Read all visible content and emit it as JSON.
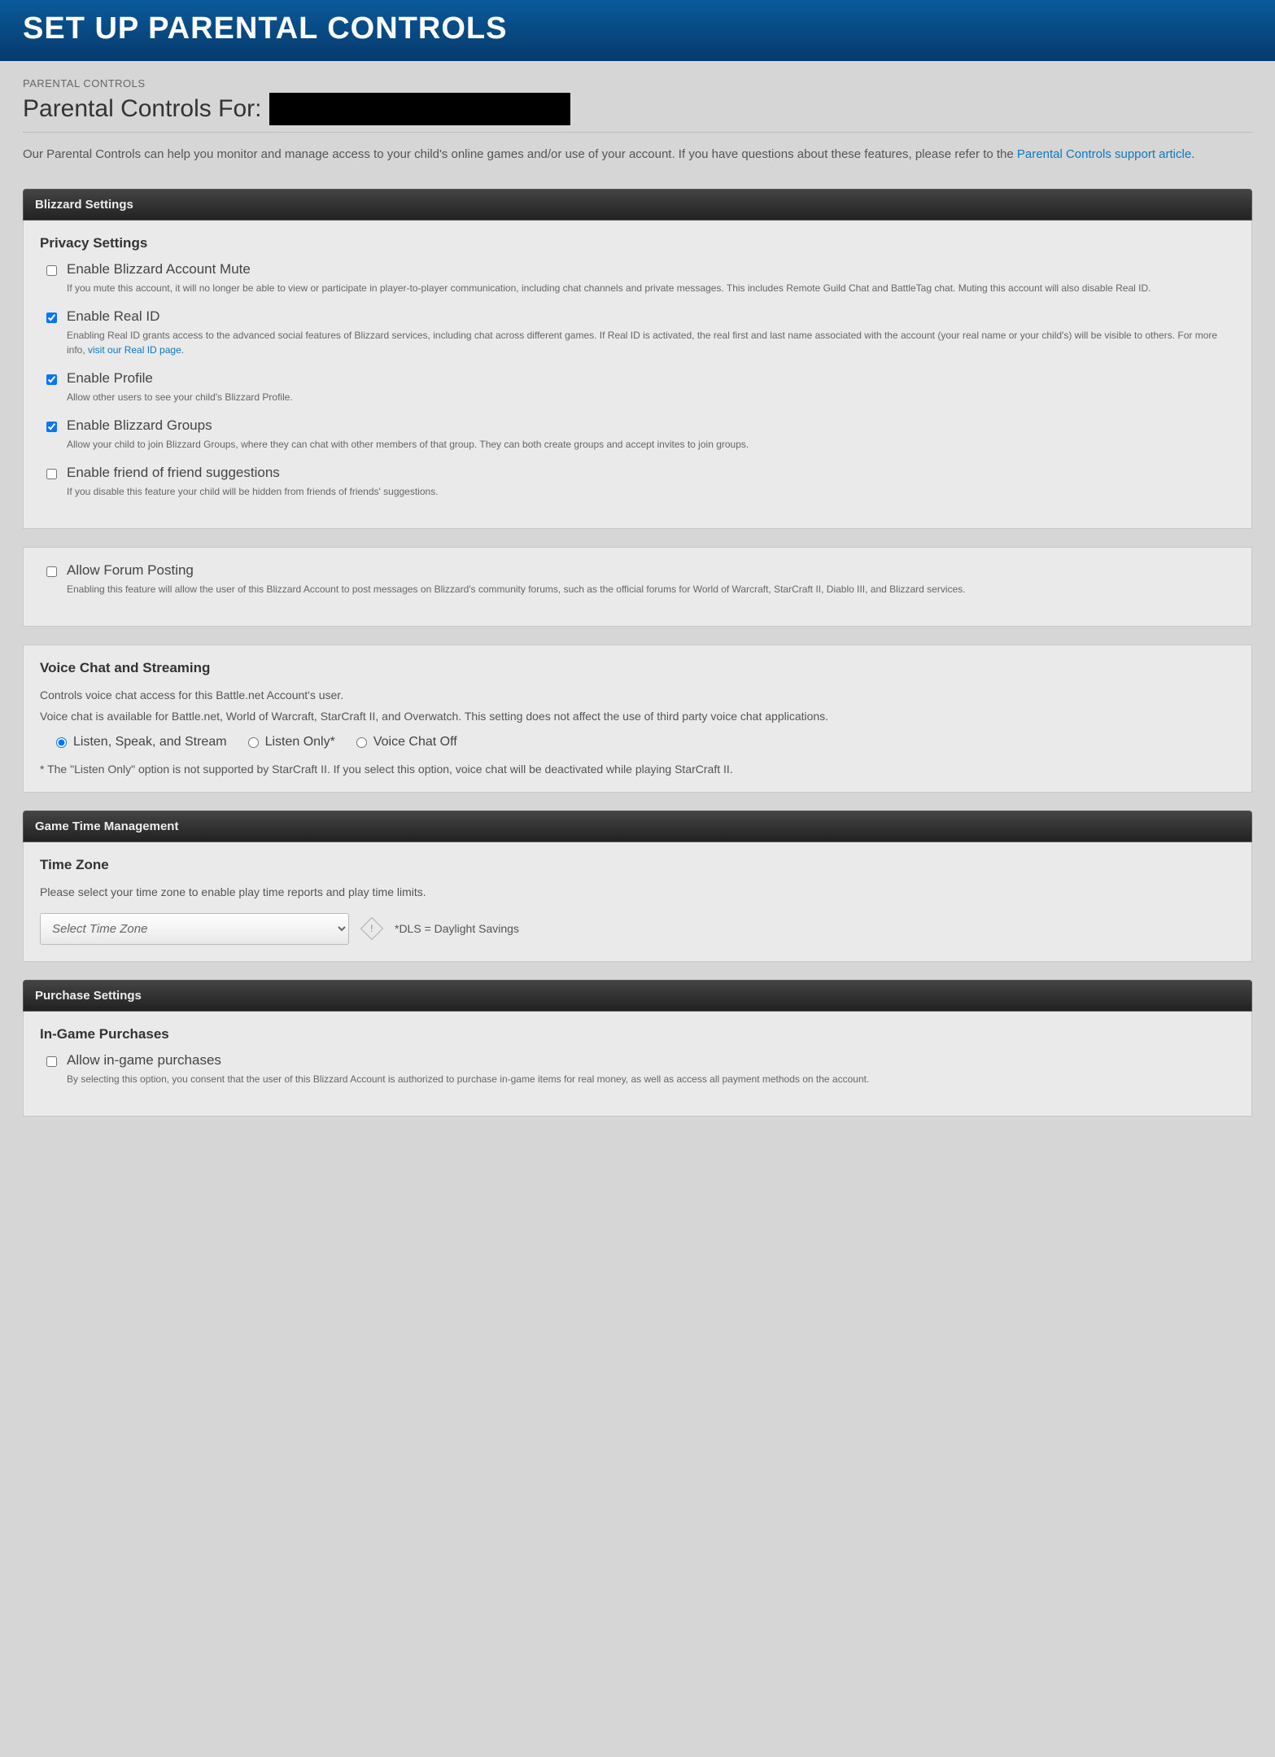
{
  "header": {
    "title": "SET UP PARENTAL CONTROLS"
  },
  "breadcrumb": "PARENTAL CONTROLS",
  "pageTitlePrefix": "Parental Controls For:",
  "intro": {
    "text_before": "Our Parental Controls can help you monitor and manage access to your child's online games and/or use of your account. If you have questions about these features, please refer to the ",
    "link": "Parental Controls support article",
    "text_after": "."
  },
  "sections": {
    "blizzard": {
      "header": "Blizzard Settings",
      "privacy": {
        "heading": "Privacy Settings",
        "items": [
          {
            "label": "Enable Blizzard Account Mute",
            "desc_before": "If you mute this account, it will no longer be able to view or participate in player-to-player communication, including chat channels and private messages. This includes Remote Guild Chat and BattleTag chat. Muting this account will also disable Real ID.",
            "link": "",
            "desc_after": "",
            "checked": false
          },
          {
            "label": "Enable Real ID",
            "desc_before": "Enabling Real ID grants access to the advanced social features of Blizzard services, including chat across different games. If Real ID is activated, the real first and last name associated with the account (your real name or your child's) will be visible to others. For more info, ",
            "link": "visit our Real ID page",
            "desc_after": ".",
            "checked": true
          },
          {
            "label": "Enable Profile",
            "desc_before": "Allow other users to see your child's Blizzard Profile.",
            "link": "",
            "desc_after": "",
            "checked": true
          },
          {
            "label": "Enable Blizzard Groups",
            "desc_before": "Allow your child to join Blizzard Groups, where they can chat with other members of that group. They can both create groups and accept invites to join groups.",
            "link": "",
            "desc_after": "",
            "checked": true
          },
          {
            "label": "Enable friend of friend suggestions",
            "desc_before": "If you disable this feature your child will be hidden from friends of friends' suggestions.",
            "link": "",
            "desc_after": "",
            "checked": false
          }
        ]
      },
      "forum": {
        "label": "Allow Forum Posting",
        "desc": "Enabling this feature will allow the user of this Blizzard Account to post messages on Blizzard's community forums, such as the official forums for World of Warcraft, StarCraft II, Diablo III, and Blizzard services.",
        "checked": false
      },
      "voice": {
        "heading": "Voice Chat and Streaming",
        "desc1": "Controls voice chat access for this Battle.net Account's user.",
        "desc2": "Voice chat is available for Battle.net, World of Warcraft, StarCraft II, and Overwatch. This setting does not affect the use of third party voice chat applications.",
        "options": [
          {
            "label": "Listen, Speak, and Stream",
            "checked": true
          },
          {
            "label": "Listen Only*",
            "checked": false
          },
          {
            "label": "Voice Chat Off",
            "checked": false
          }
        ],
        "footnote": "* The \"Listen Only\" option is not supported by StarCraft II. If you select this option, voice chat will be deactivated while playing StarCraft II."
      }
    },
    "gametime": {
      "header": "Game Time Management",
      "tz": {
        "heading": "Time Zone",
        "desc": "Please select your time zone to enable play time reports and play time limits.",
        "placeholder": "Select Time Zone",
        "dls_note": "*DLS = Daylight Savings"
      }
    },
    "purchase": {
      "header": "Purchase Settings",
      "ingame": {
        "heading": "In-Game Purchases",
        "label": "Allow in-game purchases",
        "desc": "By selecting this option, you consent that the user of this Blizzard Account is authorized to purchase in-game items for real money, as well as access all payment methods on the account.",
        "checked": false
      }
    }
  }
}
